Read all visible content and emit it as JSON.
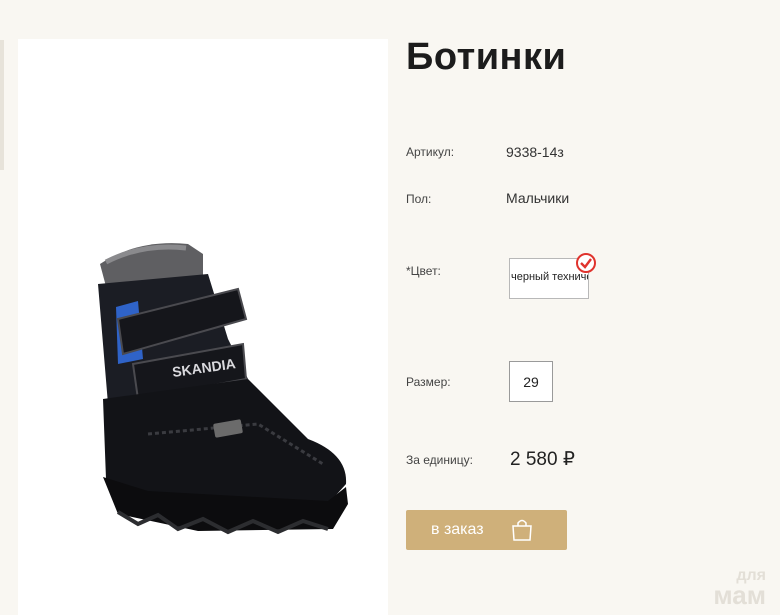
{
  "product": {
    "title": "Ботинки",
    "brand_on_image": "SKANDIA"
  },
  "fields": {
    "article_label": "Артикул:",
    "article_value": "9338-14з",
    "gender_label": "Пол:",
    "gender_value": "Мальчики",
    "color_label": "*Цвет:",
    "color_value": "черный технический",
    "size_label": "Размер:",
    "size_value": "29",
    "unit_price_label": "За единицу:",
    "unit_price_value": "2 580 ₽"
  },
  "order": {
    "button_label": "в заказ"
  },
  "watermark": {
    "line1": "для",
    "line2": "мам"
  },
  "colors": {
    "accent": "#cfb07a",
    "check": "#e0332d",
    "background": "#f9f7f2"
  }
}
